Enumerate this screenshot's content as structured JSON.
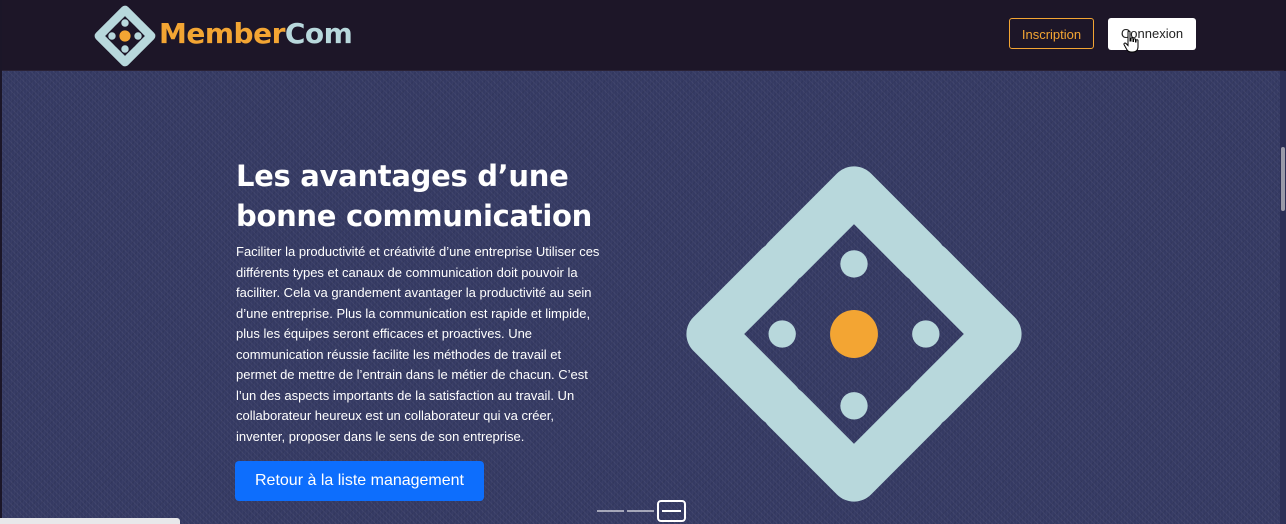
{
  "header": {
    "logo_part1": "Member",
    "logo_part2": "Com",
    "inscription_label": "Inscription",
    "connexion_label": "Connexion"
  },
  "hero": {
    "title_line1": "Les avantages d’une",
    "title_line2": "bonne communication",
    "body_lines": [
      "Faciliter la productivité et créativité d’une entreprise Utiliser ces",
      "différents types et canaux de communication doit pouvoir la",
      "faciliter. Cela va grandement avantager la productivité au sein",
      "d’une entreprise. Plus la communication est rapide et limpide,",
      "plus les équipes seront efficaces et proactives. Une",
      "communication réussie facilite les méthodes de travail et",
      "permet de mettre de l’entrain dans le métier de chacun. C’est",
      "l’un des aspects importants de la satisfaction au travail. Un",
      "collaborateur heureux est un collaborateur qui va créer,",
      "inventer, proposer dans le sens de son entreprise."
    ],
    "button_label": "Retour à la liste management"
  },
  "carousel": {
    "slide_count": 3,
    "active_index": 2
  },
  "icons": {
    "logo": "membercom-logo-icon",
    "cursor": "hand-pointer-cursor-icon"
  },
  "colors": {
    "navbar_bg": "#1d1628",
    "accent_orange": "#f3a533",
    "logo_light": "#b8d8dc",
    "hero_bg": "#353a63",
    "primary_button": "#0d6efd"
  }
}
